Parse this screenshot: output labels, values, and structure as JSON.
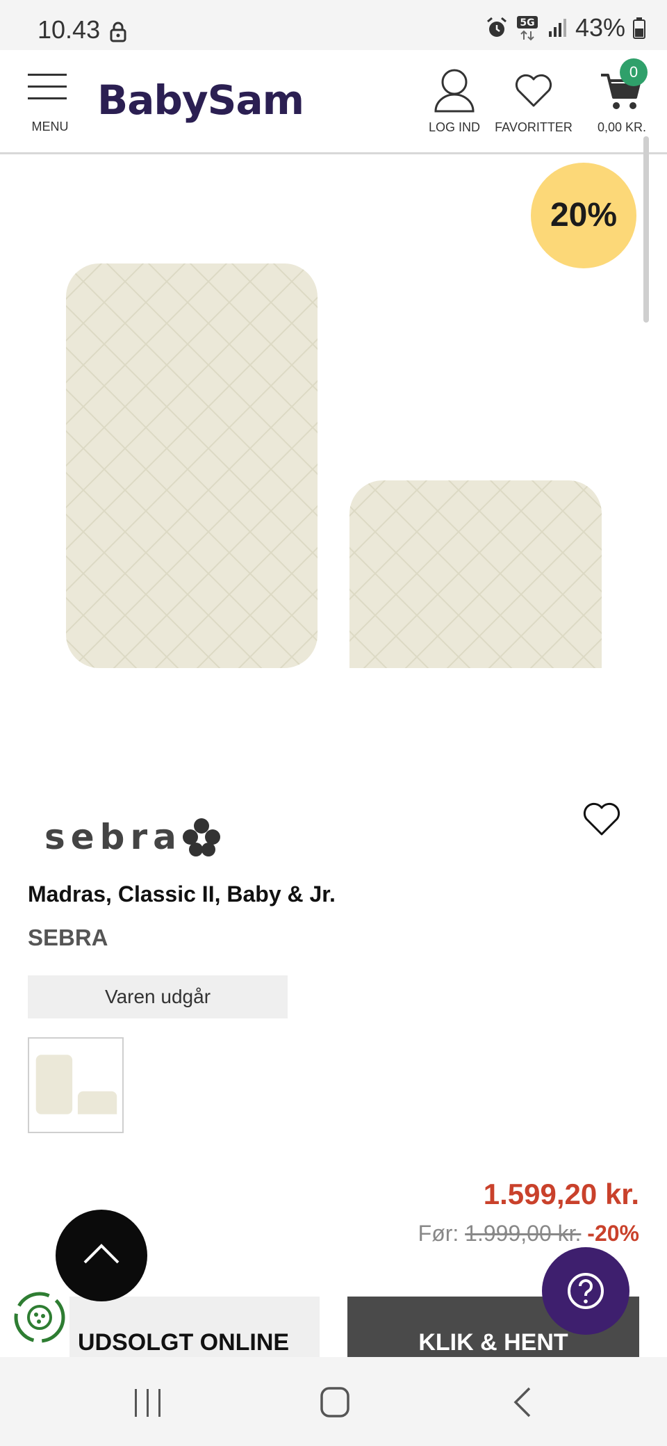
{
  "status_bar": {
    "time": "10.43",
    "network": "5G",
    "battery": "43%",
    "icons": [
      "lock-icon",
      "alarm-icon",
      "signal-icon",
      "battery-icon"
    ]
  },
  "header": {
    "menu_label": "MENU",
    "logo": "BabySam",
    "login_label": "LOG IND",
    "favorites_label": "FAVORITTER",
    "cart_total": "0,00 KR.",
    "cart_count": "0"
  },
  "product": {
    "discount_badge": "20%",
    "brand_logo": "sebra",
    "title": "Madras, Classic II, Baby & Jr.",
    "brand": "SEBRA",
    "availability": "Varen udgår",
    "price": "1.599,20 kr.",
    "old_price_prefix": "Før:",
    "old_price": "1.999,00 kr.",
    "discount_pct": "-20%"
  },
  "actions": {
    "sold_out_label": "UDSOLGT ONLINE",
    "click_collect_label": "KLIK & HENT"
  },
  "colors": {
    "brand": "#2b1f52",
    "price_red": "#c9412b",
    "badge_yellow": "#fcd878",
    "cart_green": "#2fa06a",
    "help_purple": "#3e1f6e"
  }
}
